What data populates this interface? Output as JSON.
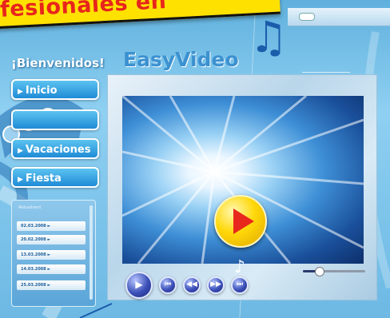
{
  "banner": {
    "text": "fesionales en"
  },
  "header": {
    "welcome": "¡Bienvenidos!",
    "logo": "EasyVideo"
  },
  "nav": {
    "items": [
      {
        "label": "Inicio"
      },
      {
        "label": ""
      },
      {
        "label": "Vacaciones"
      },
      {
        "label": "Fiesta"
      }
    ]
  },
  "dates": {
    "title": "Aktualisiert",
    "items": [
      "02.03.2008 ►",
      "20.02.2008 ►",
      "13.03.2008 ►",
      "14.03.2008 ►",
      "25.03.2008 ►"
    ]
  },
  "player": {
    "volume": 0.25,
    "controls": [
      "play",
      "first",
      "rewind",
      "forward",
      "last"
    ]
  },
  "colors": {
    "accent": "#1f8bd6",
    "banner": "#ffe100",
    "banner_text": "#e8251c",
    "play_button": "#ffd80a"
  }
}
